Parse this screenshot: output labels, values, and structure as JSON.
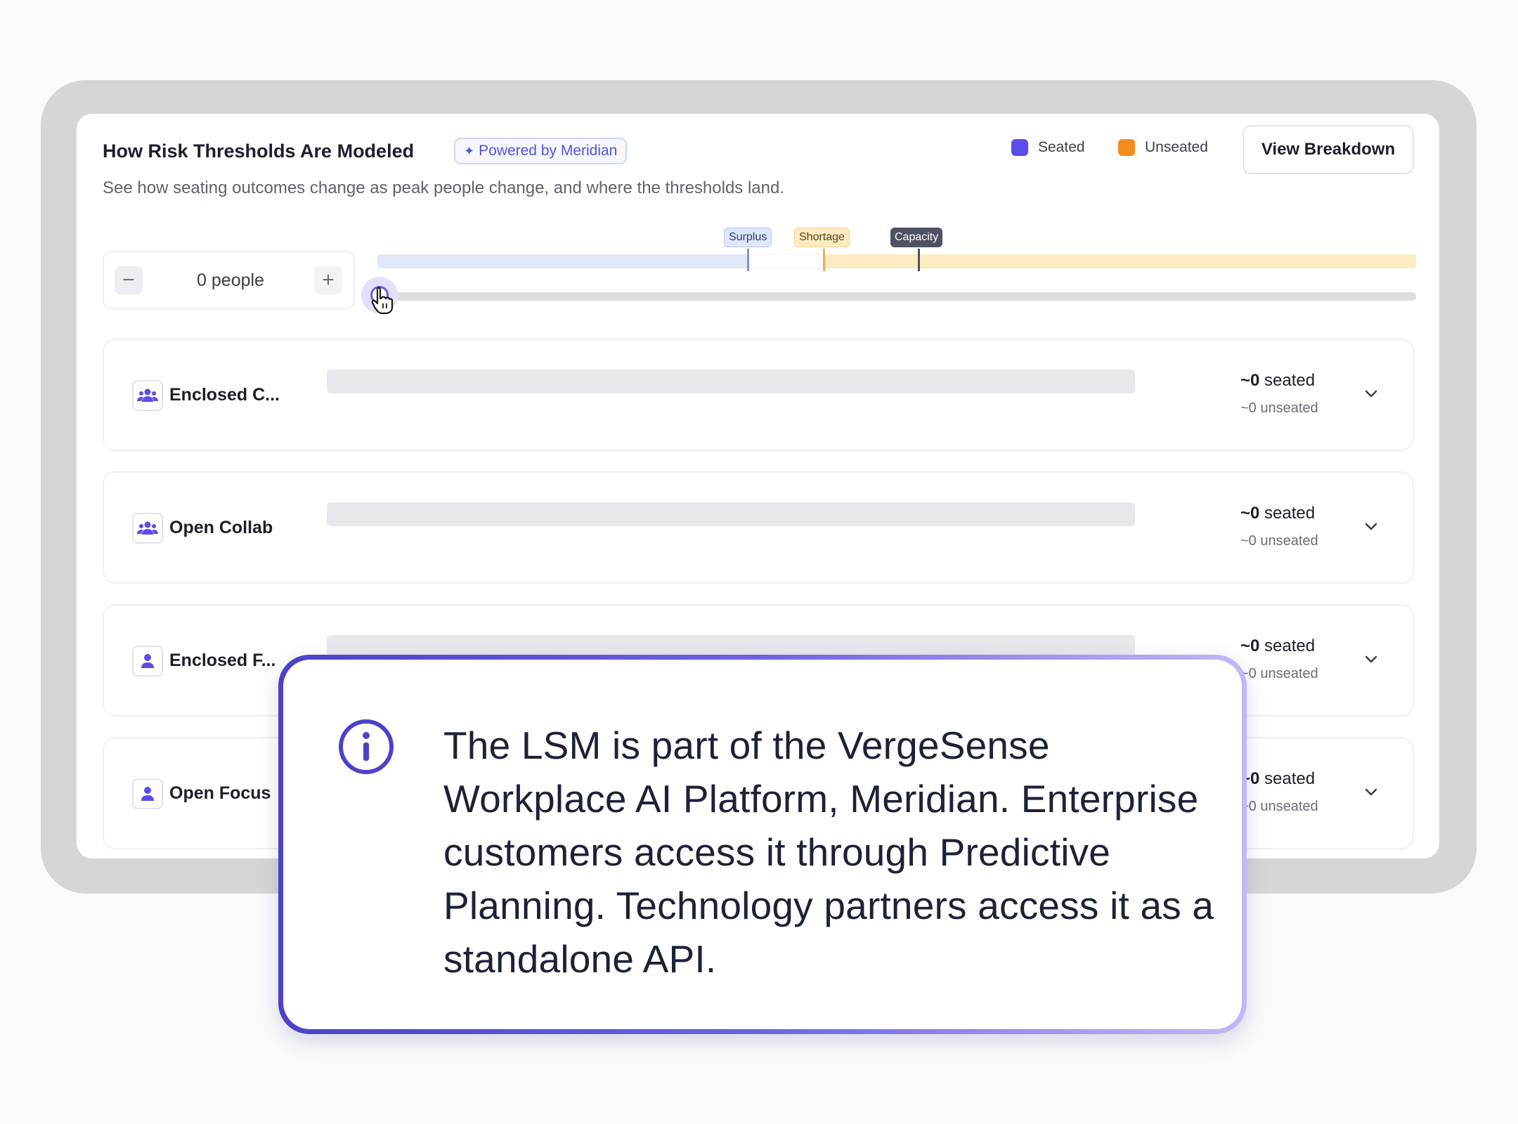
{
  "panel": {
    "title": "How Risk Thresholds Are Modeled",
    "badge": "Powered by Meridian",
    "subtitle": "See how seating outcomes change as peak people change, and where the thresholds land.",
    "legend": [
      {
        "label": "Seated",
        "color": "#5b4de8"
      },
      {
        "label": "Unseated",
        "color": "#f28c1a"
      }
    ],
    "view_button": "View Breakdown"
  },
  "stepper": {
    "minus": "−",
    "plus": "+",
    "value": "0 people"
  },
  "thresholds": {
    "surplus": "Surplus",
    "shortage": "Shortage",
    "capacity": "Capacity"
  },
  "slider": {
    "value_fraction": 0
  },
  "rows": [
    {
      "label": "Enclosed C...",
      "icon": "group-icon",
      "seated_num": "~0",
      "seated_word": " seated",
      "unseated": "~0 unseated"
    },
    {
      "label": "Open Collab",
      "icon": "group-icon",
      "seated_num": "~0",
      "seated_word": " seated",
      "unseated": "~0 unseated"
    },
    {
      "label": "Enclosed F...",
      "icon": "person-icon",
      "seated_num": "~0",
      "seated_word": " seated",
      "unseated": "~0 unseated"
    },
    {
      "label": "Open Focus",
      "icon": "person-icon",
      "seated_num": "~0",
      "seated_word": " seated",
      "unseated": "~0 unseated"
    }
  ],
  "callout": {
    "text": "The LSM is part of the VergeSense Workplace AI Platform, Meridian. Enterprise customers access it through Predictive Planning. Technology partners access it as a standalone API."
  }
}
